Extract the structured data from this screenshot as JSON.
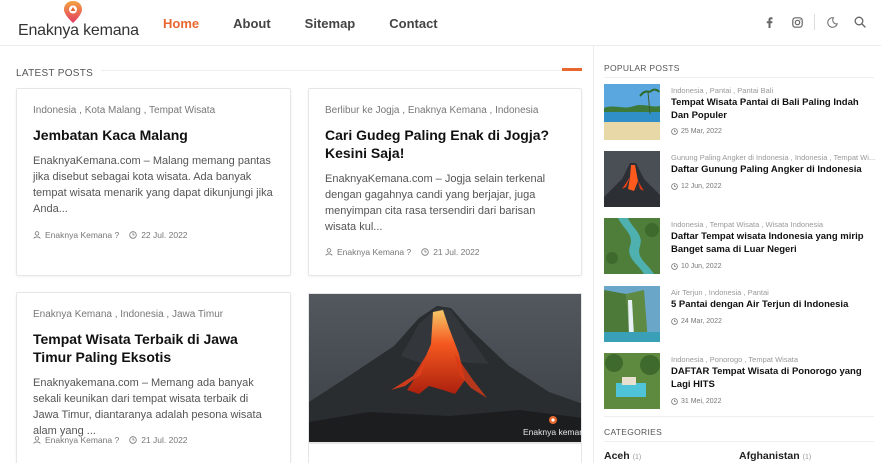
{
  "header": {
    "logo_text": "Enaknya kemana",
    "nav": [
      {
        "label": "Home",
        "active": true
      },
      {
        "label": "About",
        "active": false
      },
      {
        "label": "Sitemap",
        "active": false
      },
      {
        "label": "Contact",
        "active": false
      }
    ],
    "icons": [
      "facebook-icon",
      "instagram-icon",
      "dark-mode-icon",
      "search-icon"
    ]
  },
  "latest": {
    "title": "LATEST POSTS",
    "accent_color": "#e8672e",
    "posts": [
      {
        "categories": "Indonesia , Kota Malang , Tempat Wisata",
        "title": "Jembatan Kaca Malang",
        "excerpt": "EnaknyaKemana.com – Malang memang pantas jika disebut sebagai kota wisata. Ada banyak tempat wisata menarik yang dapat dikunjungi jika Anda...",
        "author": "Enaknya Kemana ?",
        "date": "22 Jul. 2022"
      },
      {
        "categories": "Berlibur ke Jogja , Enaknya Kemana , Indonesia",
        "title": "Cari Gudeg Paling Enak di Jogja? Kesini Saja!",
        "excerpt": "EnaknyaKemana.com – Jogja selain terkenal dengan gagahnya candi yang berjajar, juga menyimpan cita rasa tersendiri dari barisan wisata kul...",
        "author": "Enaknya Kemana ?",
        "date": "21 Jul. 2022"
      },
      {
        "categories": "Enaknya Kemana , Indonesia , Jawa Timur",
        "title": "Tempat Wisata Terbaik di Jawa Timur Paling Eksotis",
        "excerpt": "Enaknyakemana.com – Memang ada banyak sekali keunikan dari tempat wisata terbaik di Jawa Timur, diantaranya adalah pesona wisata alam yang ...",
        "author": "Enaknya Kemana ?",
        "date": "21 Jul. 2022"
      }
    ],
    "image_watermark": "Enaknya kemana"
  },
  "sidebar": {
    "popular_title": "POPULAR POSTS",
    "popular": [
      {
        "categories": "Indonesia , Pantai , Pantai Bali",
        "title": "Tempat Wisata Pantai di Bali Paling Indah Dan Populer",
        "date": "25 Mar, 2022"
      },
      {
        "categories": "Gunung Paling Angker di Indonesia , Indonesia , Tempat Wi...",
        "title": "Daftar Gunung Paling Angker di Indonesia",
        "date": "12 Jun, 2022"
      },
      {
        "categories": "Indonesia , Tempat Wisata , Wisata Indonesia",
        "title": "Daftar Tempat wisata Indonesia yang mirip Banget sama di Luar Negeri",
        "date": "10 Jun, 2022"
      },
      {
        "categories": "Air Terjun , Indonesia , Pantai",
        "title": "5 Pantai dengan Air Terjun di Indonesia",
        "date": "24 Mar, 2022"
      },
      {
        "categories": "Indonesia , Ponorogo , Tempat Wisata",
        "title": "DAFTAR Tempat Wisata di Ponorogo yang Lagi HITS",
        "date": "31 Mei, 2022"
      }
    ],
    "categories_title": "CATEGORIES",
    "categories": [
      {
        "name": "Aceh",
        "count": "(1)"
      },
      {
        "name": "Afghanistan",
        "count": "(1)"
      }
    ]
  }
}
